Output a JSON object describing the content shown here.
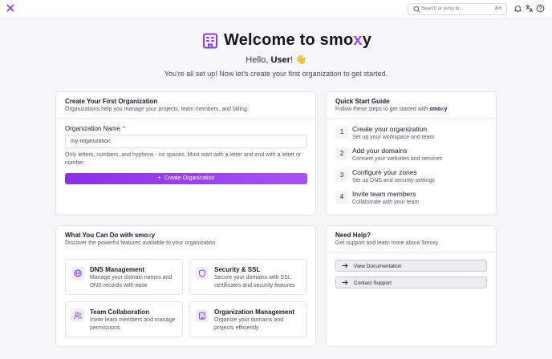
{
  "topbar": {
    "search_placeholder": "Search or jump to...",
    "search_shortcut": "⌘K",
    "icons": [
      "logo-x-icon",
      "search-icon",
      "bell-icon",
      "translate-icon",
      "help-icon"
    ]
  },
  "hero": {
    "title_prefix": "Welcome to smo",
    "title_accent": "x",
    "title_suffix": "y",
    "hello_prefix": "Hello, ",
    "hello_name": "User",
    "hello_suffix": "! 👋",
    "subtitle": "You're all set up! Now let's create your first organization to get started."
  },
  "create_org": {
    "title": "Create Your First Organization",
    "description": "Organizations help you manage your projects, team members, and billing.",
    "field_label": "Organization Name",
    "required_mark": "*",
    "input_value": "my-organization",
    "hint": "Only letters, numbers, and hyphens - no spaces. Must start with a letter and end with a letter or number.",
    "button_label": "Create Organization"
  },
  "quick_start": {
    "title": "Quick Start Guide",
    "description_prefix": "Follow these steps to get started with ",
    "brand_prefix": "smo",
    "brand_accent": "x",
    "brand_suffix": "y",
    "steps": [
      {
        "num": "1",
        "title": "Create your organization",
        "desc": "Set up your workspace and team"
      },
      {
        "num": "2",
        "title": "Add your domains",
        "desc": "Connect your websites and services"
      },
      {
        "num": "3",
        "title": "Configure your zones",
        "desc": "Set up DNS and security settings"
      },
      {
        "num": "4",
        "title": "Invite team members",
        "desc": "Collaborate with your team"
      }
    ]
  },
  "features": {
    "title_prefix": "What You Can Do with ",
    "brand_prefix": "smo",
    "brand_accent": "x",
    "brand_suffix": "y",
    "description": "Discover the powerful features available to your organization",
    "items": [
      {
        "icon": "globe-icon",
        "title": "DNS Management",
        "desc": "Manage your domain names and DNS records with ease"
      },
      {
        "icon": "shield-icon",
        "title": "Security & SSL",
        "desc": "Secure your domains with SSL certificates and security features"
      },
      {
        "icon": "users-icon",
        "title": "Team Collaboration",
        "desc": "Invite team members and manage permissions"
      },
      {
        "icon": "building-icon",
        "title": "Organization Management",
        "desc": "Organize your domains and projects efficiently"
      }
    ]
  },
  "help": {
    "title": "Need Help?",
    "description": "Get support and learn more about Smoxy",
    "buttons": [
      {
        "label": "View Documentation"
      },
      {
        "label": "Contact Support"
      }
    ]
  },
  "colors": {
    "accent": "#9b45f3",
    "button_gradient_start": "#8b2fe8",
    "button_gradient_end": "#a653f5",
    "background": "#f6f6f8"
  }
}
